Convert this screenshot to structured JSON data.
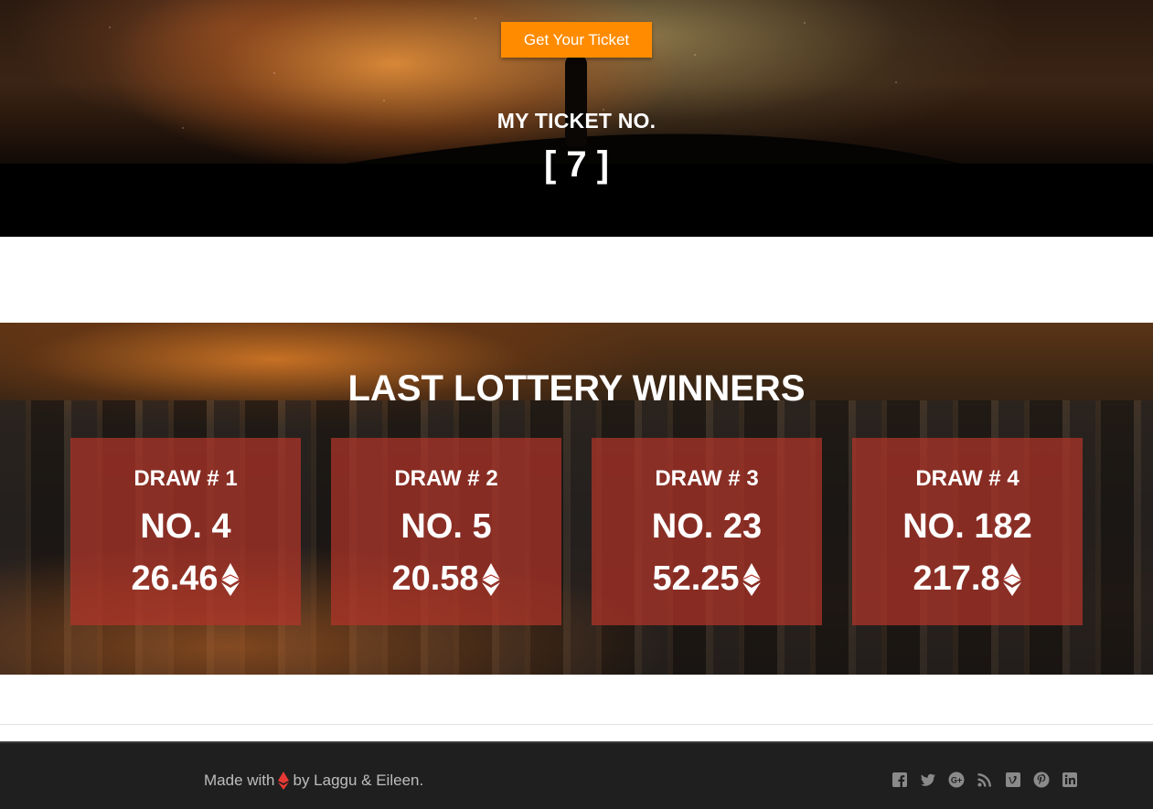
{
  "hero": {
    "button_label": "Get Your Ticket",
    "ticket_label": "MY TICKET NO.",
    "ticket_number": "[ 7 ]"
  },
  "winners": {
    "title": "LAST LOTTERY WINNERS",
    "cards": [
      {
        "draw": "DRAW # 1",
        "number": "NO. 4",
        "amount": "26.46"
      },
      {
        "draw": "DRAW # 2",
        "number": "NO. 5",
        "amount": "20.58"
      },
      {
        "draw": "DRAW # 3",
        "number": "NO. 23",
        "amount": "52.25"
      },
      {
        "draw": "DRAW # 4",
        "number": "NO. 182",
        "amount": "217.8"
      }
    ],
    "currency_icon": "ethereum-icon"
  },
  "footer": {
    "credit_prefix": "Made with",
    "credit_suffix": "by Laggu & Eileen.",
    "social_icons": [
      "facebook-icon",
      "twitter-icon",
      "google-plus-icon",
      "rss-icon",
      "vimeo-icon",
      "pinterest-icon",
      "linkedin-icon"
    ]
  },
  "colors": {
    "button": "#ff8c00",
    "card": "#b2342a",
    "footer_bg": "#1f1f1f",
    "heart": "#e53935"
  }
}
